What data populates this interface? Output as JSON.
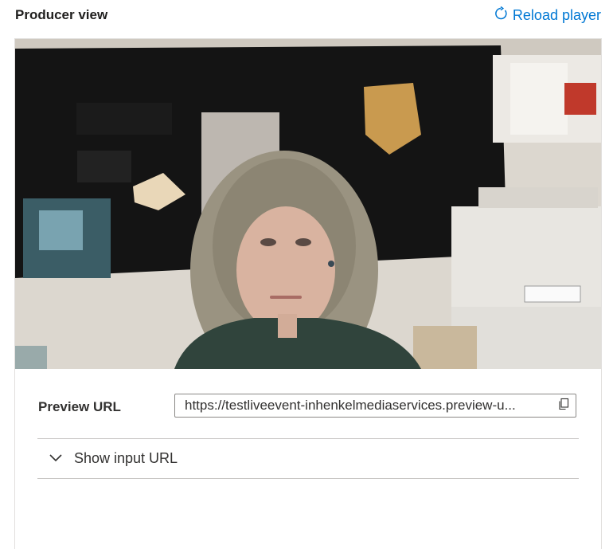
{
  "header": {
    "title": "Producer view",
    "reload_label": "Reload player"
  },
  "player": {
    "description_icon": "video-frame"
  },
  "preview": {
    "label": "Preview URL",
    "url": "https://testliveevent-inhenkelmediaservices.preview-u..."
  },
  "expander": {
    "label": "Show input URL"
  },
  "colors": {
    "accent": "#0078d4",
    "text": "#323130",
    "border": "#e1dfdd"
  }
}
